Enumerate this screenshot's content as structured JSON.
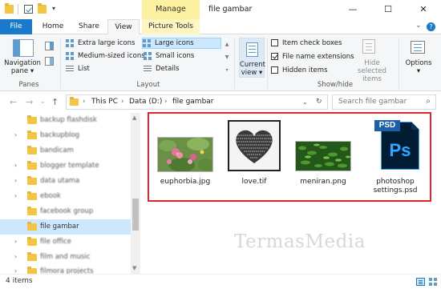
{
  "window": {
    "title": "file gambar",
    "contextual_group": "Manage",
    "minimize": "—",
    "maximize": "☐",
    "close": "✕"
  },
  "tabs": [
    {
      "label": "File"
    },
    {
      "label": "Home"
    },
    {
      "label": "Share"
    },
    {
      "label": "View"
    },
    {
      "label": "Picture Tools"
    }
  ],
  "ribbon": {
    "panes": {
      "group_label": "Panes",
      "navigation_pane": "Navigation",
      "navigation_pane_2": "pane ▾"
    },
    "layout": {
      "group_label": "Layout",
      "items": [
        "Extra large icons",
        "Large icons",
        "Medium-sized icons",
        "Small icons",
        "List",
        "Details"
      ]
    },
    "current_view": {
      "label": "Current",
      "label2": "view ▾"
    },
    "show_hide": {
      "group_label": "Show/hide",
      "item_check_boxes": "Item check boxes",
      "file_name_extensions": "File name extensions",
      "hidden_items": "Hidden items",
      "hide_selected": "Hide selected",
      "hide_selected_2": "items"
    },
    "options": {
      "label": "Options",
      "label2": "▾"
    }
  },
  "address": {
    "crumbs": [
      "This PC",
      "Data (D:)",
      "file gambar"
    ],
    "search_placeholder": "Search file gambar"
  },
  "nav_items": [
    {
      "label": "backup flashdisk",
      "blur": true
    },
    {
      "label": "backupblog",
      "blur": true
    },
    {
      "label": "bandicam",
      "blur": true
    },
    {
      "label": "blogger template",
      "blur": true
    },
    {
      "label": "data utama",
      "blur": true
    },
    {
      "label": "ebook",
      "blur": true
    },
    {
      "label": "facebook group",
      "blur": true
    },
    {
      "label": "file gambar",
      "blur": false
    },
    {
      "label": "file office",
      "blur": true
    },
    {
      "label": "film and music",
      "blur": true
    },
    {
      "label": "filmora projects",
      "blur": true
    }
  ],
  "files": [
    {
      "name": "euphorbia.jpg",
      "name2": ""
    },
    {
      "name": "love.tif",
      "name2": ""
    },
    {
      "name": "meniran.png",
      "name2": ""
    },
    {
      "name": "photoshop",
      "name2": "settings.psd"
    }
  ],
  "psd_icon": {
    "badge": "PSD",
    "text": "Ps"
  },
  "watermark": "TermasMedia",
  "status": {
    "item_count": "4 items"
  },
  "colors": {
    "accent": "#1979ca",
    "highlight": "#cce8ff",
    "manage_tab": "#fcf1a0",
    "red_frame": "#e0242b"
  }
}
